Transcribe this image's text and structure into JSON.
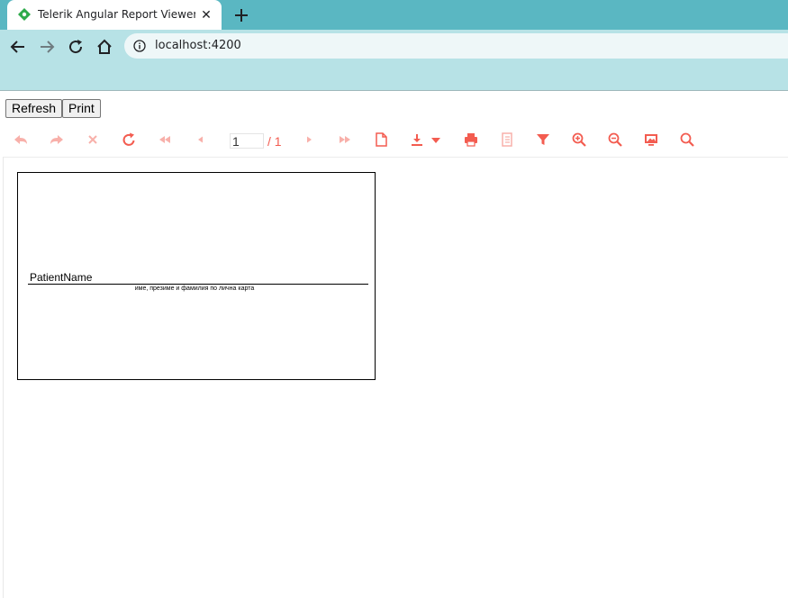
{
  "browser": {
    "tab_title": "Telerik Angular Report Viewer De",
    "tab_close": "✕",
    "url": "localhost:4200"
  },
  "page": {
    "refresh_label": "Refresh",
    "print_label": "Print"
  },
  "viewer": {
    "toolbar": {
      "accent_color": "#f35c50",
      "current_page": "1",
      "page_total": "/ 1",
      "icons": [
        "back-icon",
        "forward-icon",
        "stop-icon",
        "refresh-icon",
        "first-page-icon",
        "previous-page-icon",
        "next-page-icon",
        "last-page-icon",
        "page-mode-icon",
        "export-icon",
        "print-icon",
        "document-map-icon",
        "parameters-icon",
        "zoom-in-icon",
        "zoom-out-icon",
        "toggle-zoom-icon",
        "search-icon"
      ]
    },
    "report": {
      "field_value": "PatientName",
      "field_caption": "име, презиме и фамилия по лична карта"
    }
  }
}
